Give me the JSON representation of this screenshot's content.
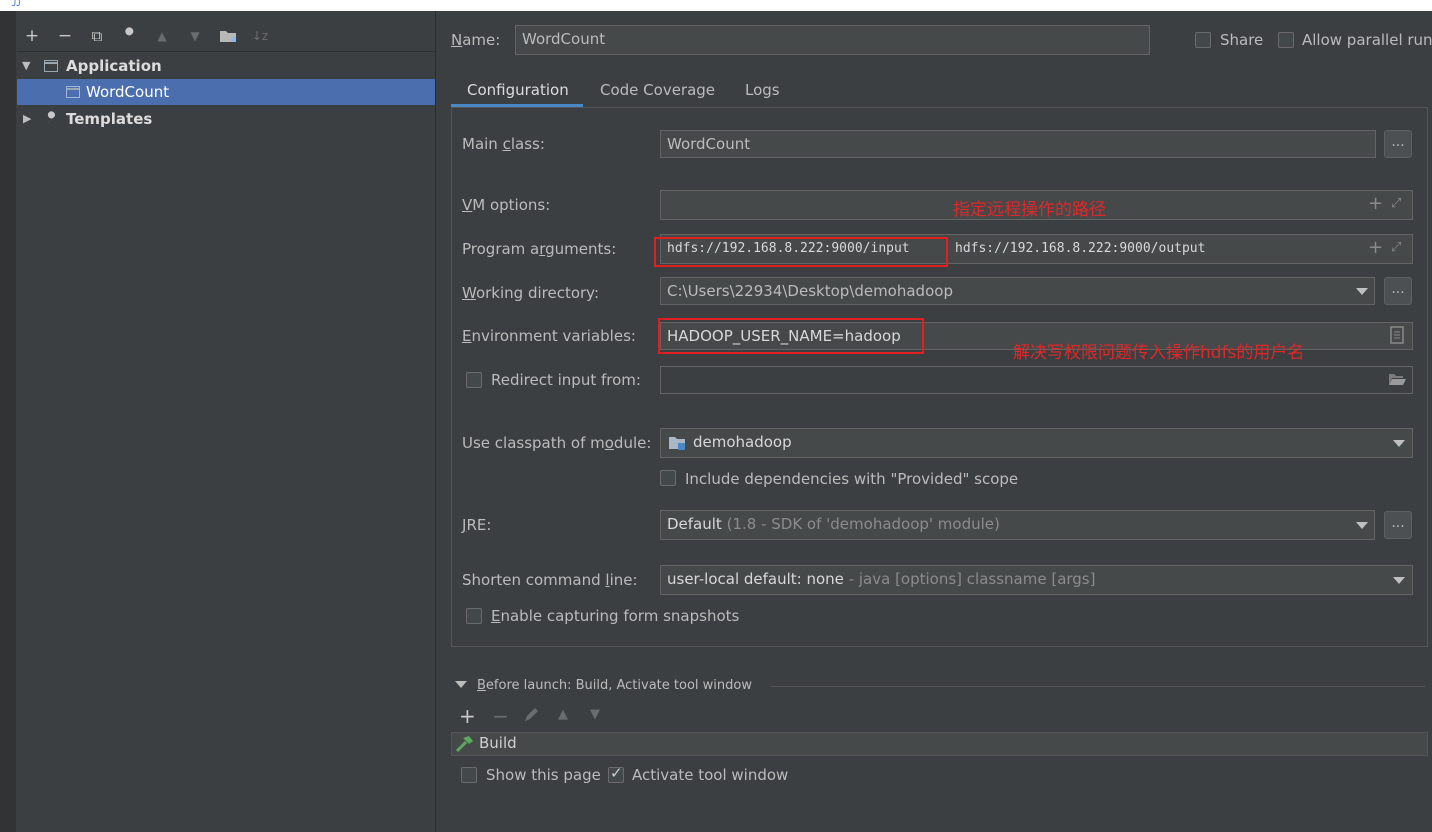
{
  "window": {
    "title_glyph": "ᴊᴊ"
  },
  "left_toolbar": {
    "icons": [
      "plus-icon",
      "minus-icon",
      "copy-icon",
      "wrench-icon",
      "arrow-up-icon",
      "arrow-down-icon",
      "folder-icon",
      "sort-icon"
    ],
    "add": "+",
    "remove": "−",
    "copy": "⧉",
    "wrench": "🔧",
    "up": "▲",
    "down": "▼",
    "folder": "▆",
    "sort": "↓z"
  },
  "tree": {
    "application": "Application",
    "wordcount": "WordCount",
    "templates": "Templates"
  },
  "header": {
    "name_label": "Name:",
    "name_value": "WordCount",
    "share": "Share",
    "allow_parallel": "Allow parallel run"
  },
  "tabs": [
    "Configuration",
    "Code Coverage",
    "Logs"
  ],
  "form": {
    "main_class_label": "Main class:",
    "main_class_value": "WordCount",
    "vm_options_label": "VM options:",
    "vm_options_value": "",
    "program_args_label": "Program arguments:",
    "program_args_value_1": "hdfs://192.168.8.222:9000/input",
    "program_args_value_2": "hdfs://192.168.8.222:9000/output",
    "working_dir_label": "Working directory:",
    "working_dir_value": "C:\\Users\\22934\\Desktop\\demohadoop",
    "env_vars_label": "Environment variables:",
    "env_vars_value": "HADOOP_USER_NAME=hadoop",
    "redirect_label": "Redirect input from:",
    "classpath_label": "Use classpath of module:",
    "classpath_value": "demohadoop",
    "include_deps_label": "Include dependencies with \"Provided\" scope",
    "jre_label": "JRE:",
    "jre_value_main": "Default",
    "jre_value_detail": "(1.8 - SDK of 'demohadoop' module)",
    "shorten_label": "Shorten command line:",
    "shorten_value_main": "user-local default: none",
    "shorten_value_detail": "- java [options] classname [args]",
    "snapshots_label": "Enable capturing form snapshots",
    "dots": "..."
  },
  "annotations": {
    "vm_note": "指定远程操作的路径",
    "env_note": "解决写权限问题传入操作hdfs的用户名"
  },
  "before_launch": {
    "title": "Before launch: Build, Activate tool window",
    "build_item": "Build",
    "show_page": "Show this page",
    "activate_tool": "Activate tool window",
    "activate_checked": true
  }
}
